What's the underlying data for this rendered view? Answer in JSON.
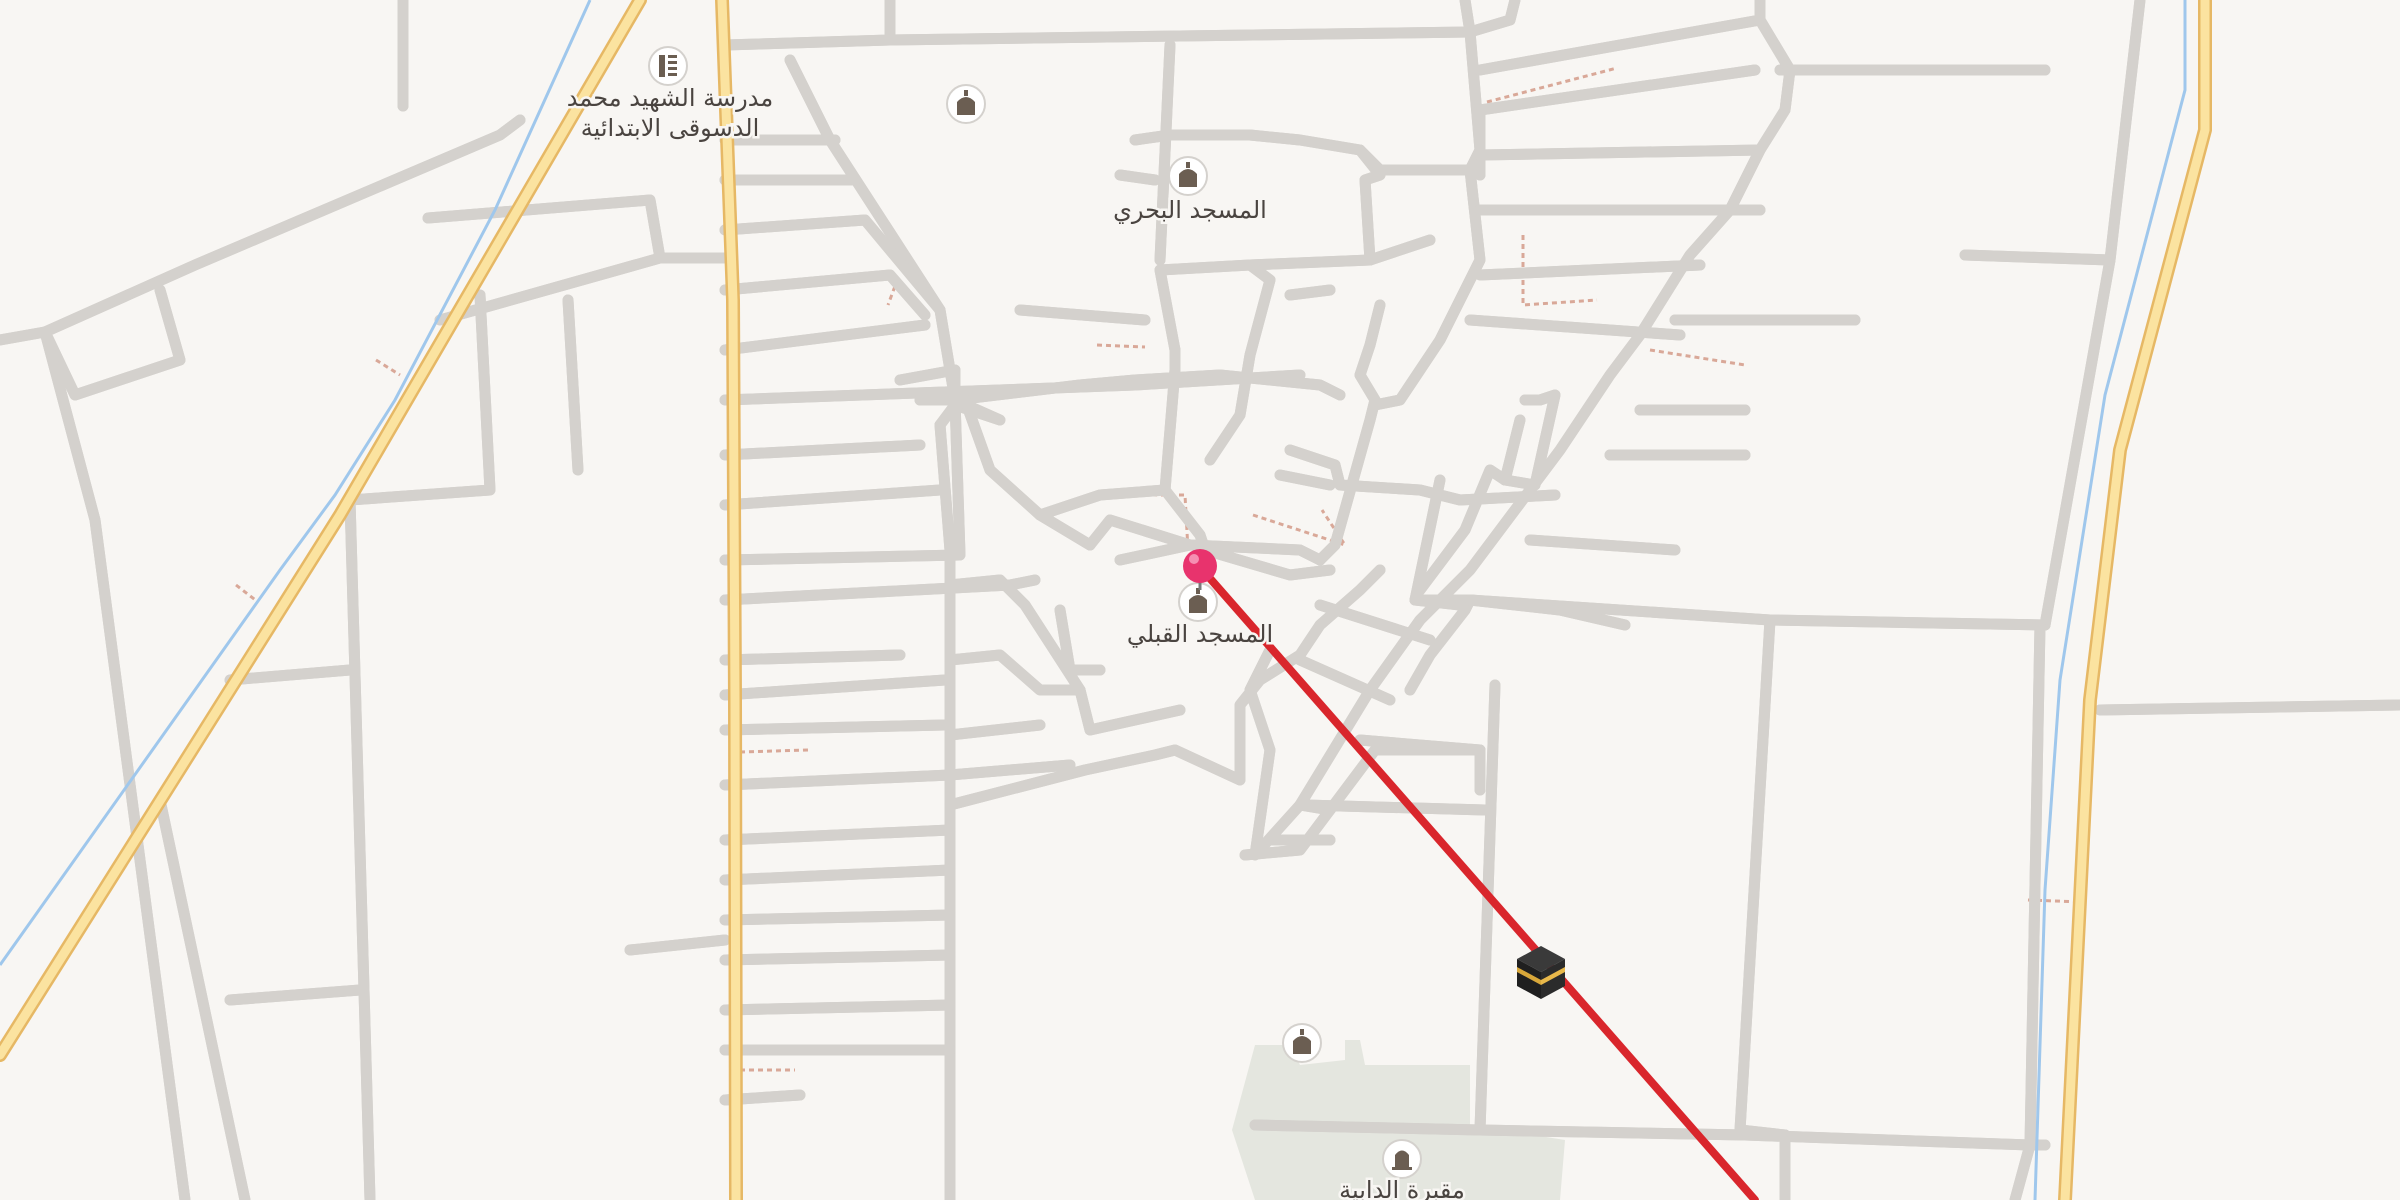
{
  "map": {
    "colors": {
      "background": "#f8f6f3",
      "road_fill": "#ffffff",
      "road_casing": "#d4d1cd",
      "major_road_fill": "#fbe3a0",
      "major_road_casing": "#e6b865",
      "canal": "#9fc7ec",
      "path_dashed": "#d9a898",
      "cemetery_area": "#e4e6df",
      "poi_icon": "#6b5e52",
      "pin": "#e8336d",
      "qibla_line": "#d9262c"
    },
    "pois": [
      {
        "id": "school",
        "icon": "school-icon",
        "label_lines": [
          "مدرسة الشهيد محمد",
          "الدسوقى الابتدائية"
        ]
      },
      {
        "id": "mosque-north-1",
        "icon": "mosque-icon",
        "label_lines": []
      },
      {
        "id": "bahari-mosque",
        "icon": "mosque-icon",
        "label_lines": [
          "المسجد البحري"
        ]
      },
      {
        "id": "qibli-mosque",
        "icon": "mosque-icon",
        "label_lines": [
          "المسجد القبلي"
        ]
      },
      {
        "id": "mosque-south",
        "icon": "mosque-icon",
        "label_lines": []
      },
      {
        "id": "cemetery",
        "icon": "cemetery-icon",
        "label_lines": [
          "مقبرة الدابية"
        ]
      }
    ],
    "pin": {
      "icon": "location-pin-icon"
    },
    "qibla": {
      "icon": "kaaba-icon"
    }
  }
}
